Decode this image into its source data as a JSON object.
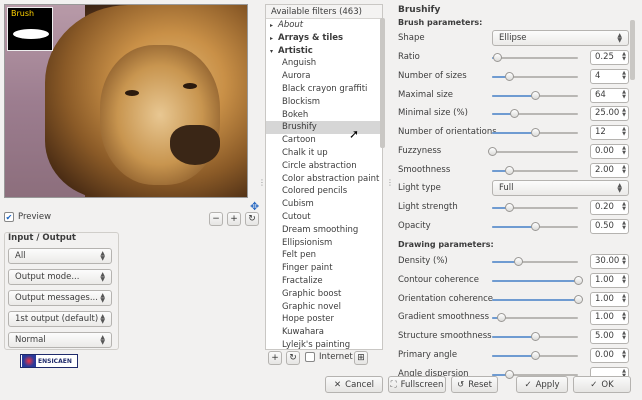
{
  "preview": {
    "brush_label": "Brush",
    "checkbox_label": "Preview"
  },
  "io": {
    "title": "Input / Output",
    "combos": [
      "All",
      "Output mode...",
      "Output messages...",
      "1st output (default)",
      "Normal"
    ],
    "logo_text": "ENSICAEN"
  },
  "filters": {
    "header": "Available filters (463)",
    "items": [
      {
        "label": "About",
        "type": "cat-collapsed-italic"
      },
      {
        "label": "Arrays & tiles",
        "type": "cat-collapsed"
      },
      {
        "label": "Artistic",
        "type": "cat-open"
      },
      {
        "label": "Anguish"
      },
      {
        "label": "Aurora"
      },
      {
        "label": "Black crayon graffiti"
      },
      {
        "label": "Blockism"
      },
      {
        "label": "Bokeh"
      },
      {
        "label": "Brushify",
        "selected": true
      },
      {
        "label": "Cartoon"
      },
      {
        "label": "Chalk it up"
      },
      {
        "label": "Circle abstraction"
      },
      {
        "label": "Color abstraction paint"
      },
      {
        "label": "Colored pencils"
      },
      {
        "label": "Cubism"
      },
      {
        "label": "Cutout"
      },
      {
        "label": "Dream smoothing"
      },
      {
        "label": "Ellipsionism"
      },
      {
        "label": "Felt pen"
      },
      {
        "label": "Finger paint"
      },
      {
        "label": "Fractalize"
      },
      {
        "label": "Graphic boost"
      },
      {
        "label": "Graphic novel"
      },
      {
        "label": "Hope poster"
      },
      {
        "label": "Kuwahara"
      },
      {
        "label": "Lylejk's painting"
      }
    ],
    "internet_label": "Internet"
  },
  "params": {
    "title": "Brushify",
    "brush_section": "Brush parameters:",
    "drawing_section": "Drawing parameters:",
    "shape": {
      "label": "Shape",
      "value": "Ellipse"
    },
    "light_type": {
      "label": "Light type",
      "value": "Full"
    },
    "brush_rows": [
      {
        "label": "Ratio",
        "value": "0.25",
        "level": 0.06
      },
      {
        "label": "Number of sizes",
        "value": "4",
        "level": 0.2
      },
      {
        "label": "Maximal size",
        "value": "64",
        "level": 0.5
      },
      {
        "label": "Minimal size (%)",
        "value": "25.00",
        "level": 0.25
      },
      {
        "label": "Number of orientations",
        "value": "12",
        "level": 0.5
      },
      {
        "label": "Fuzzyness",
        "value": "0.00",
        "level": 0.0
      },
      {
        "label": "Smoothness",
        "value": "2.00",
        "level": 0.2
      }
    ],
    "light_rows": [
      {
        "label": "Light strength",
        "value": "0.20",
        "level": 0.2
      },
      {
        "label": "Opacity",
        "value": "0.50",
        "level": 0.5
      }
    ],
    "drawing_rows": [
      {
        "label": "Density (%)",
        "value": "30.00",
        "level": 0.3
      },
      {
        "label": "Contour coherence",
        "value": "1.00",
        "level": 1.0
      },
      {
        "label": "Orientation coherence",
        "value": "1.00",
        "level": 1.0
      },
      {
        "label": "Gradient smoothness",
        "value": "1.00",
        "level": 0.1
      },
      {
        "label": "Structure smoothness",
        "value": "5.00",
        "level": 0.5
      },
      {
        "label": "Primary angle",
        "value": "0.00",
        "level": 0.5
      },
      {
        "label": "Angle dispersion",
        "value": "",
        "level": 0.2
      }
    ]
  },
  "buttons": {
    "cancel": "Cancel",
    "fullscreen": "Fullscreen",
    "reset": "Reset",
    "apply": "Apply",
    "ok": "OK"
  }
}
